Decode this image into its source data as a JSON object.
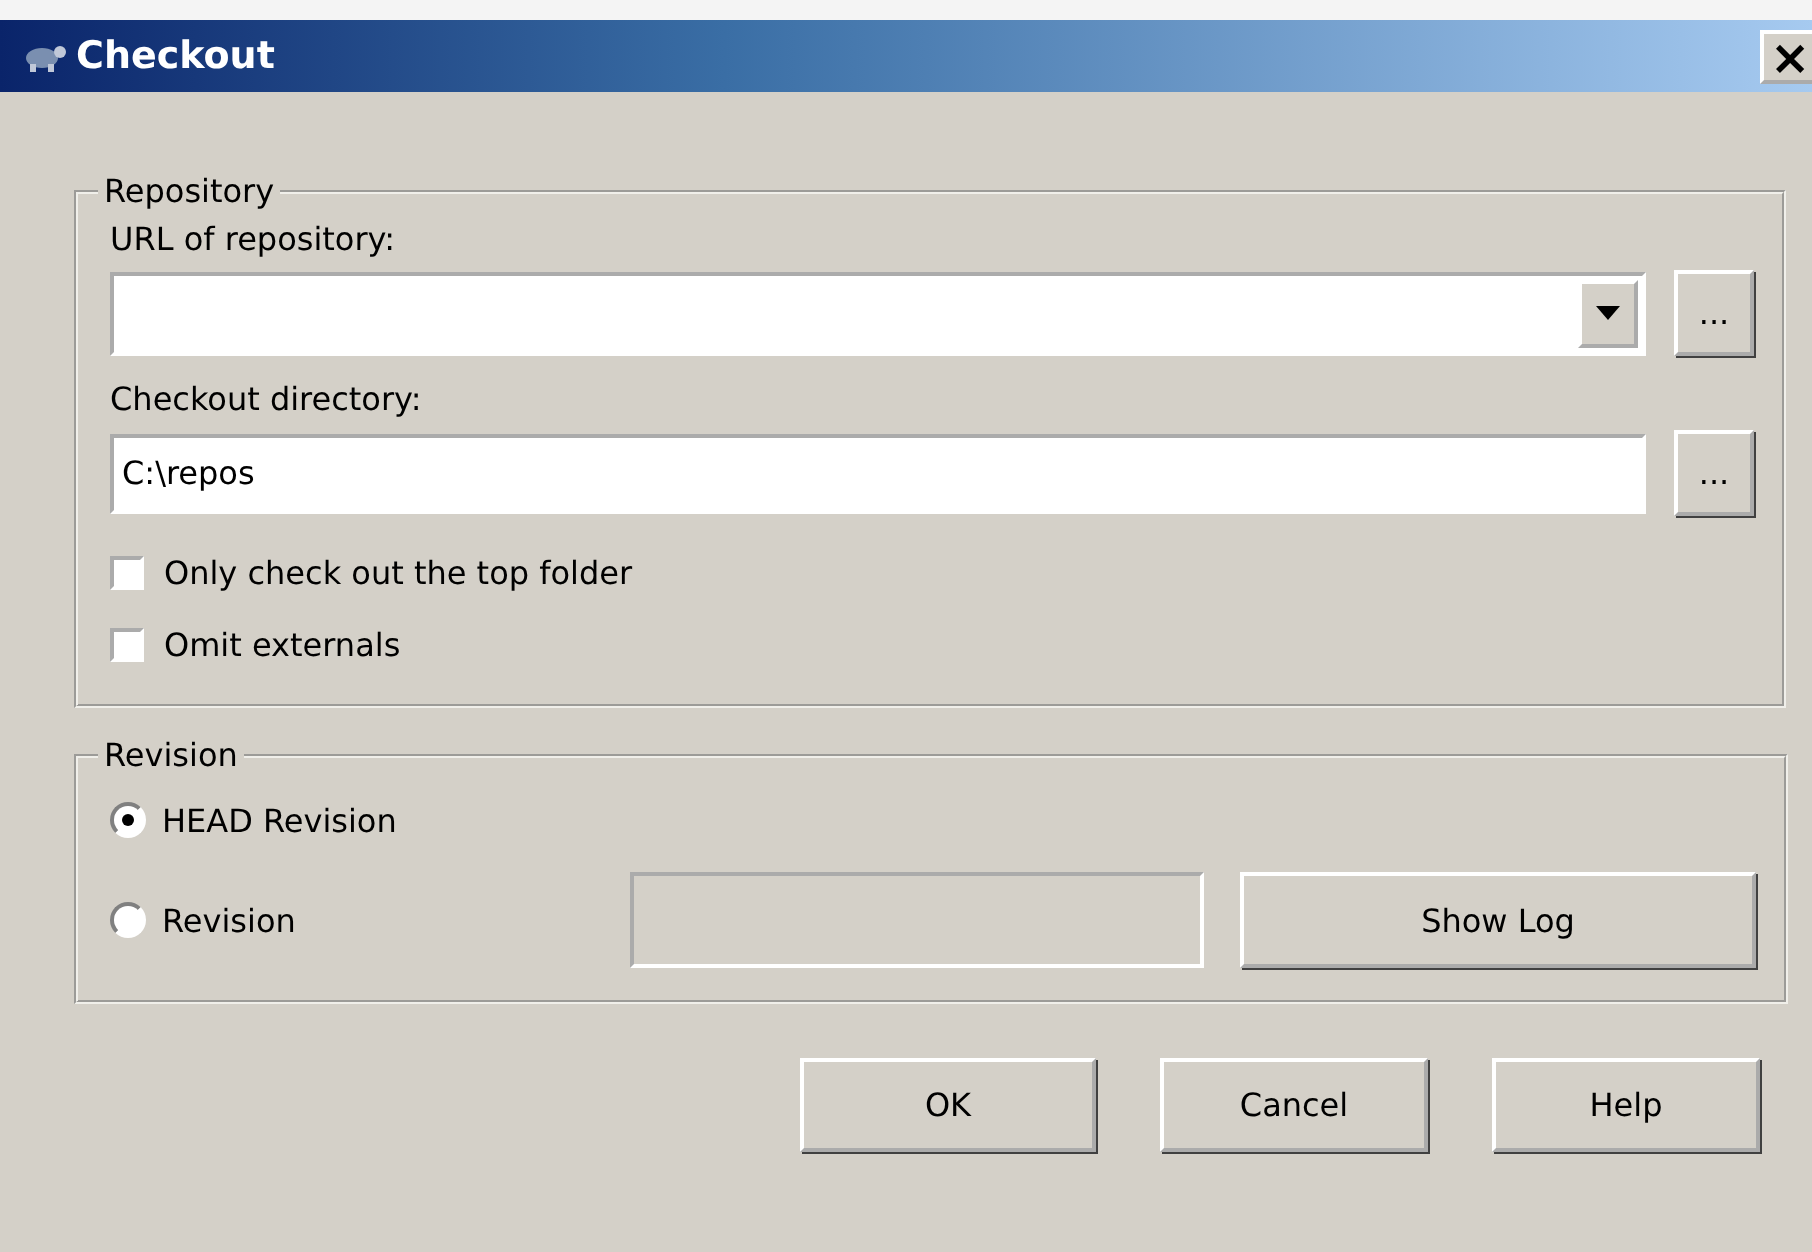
{
  "window": {
    "title": "Checkout",
    "close": "×"
  },
  "repository": {
    "legend": "Repository",
    "url": {
      "label": "URL of repository:",
      "browse": "..."
    },
    "directory": {
      "label": "Checkout directory:",
      "value": "C:\\repos",
      "browse": "..."
    },
    "options": [
      {
        "label": "Only check out the top folder",
        "checked": false
      },
      {
        "label": "Omit externals",
        "checked": false
      }
    ]
  },
  "revision": {
    "legend": "Revision",
    "choices": [
      {
        "label": "HEAD Revision",
        "selected": true
      },
      {
        "label": "Revision",
        "selected": false
      }
    ],
    "field": {
      "disabled": true
    },
    "show_log": {
      "label": "Show Log"
    }
  },
  "buttons": [
    {
      "label": "OK"
    },
    {
      "label": "Cancel"
    },
    {
      "label": "Help"
    }
  ]
}
